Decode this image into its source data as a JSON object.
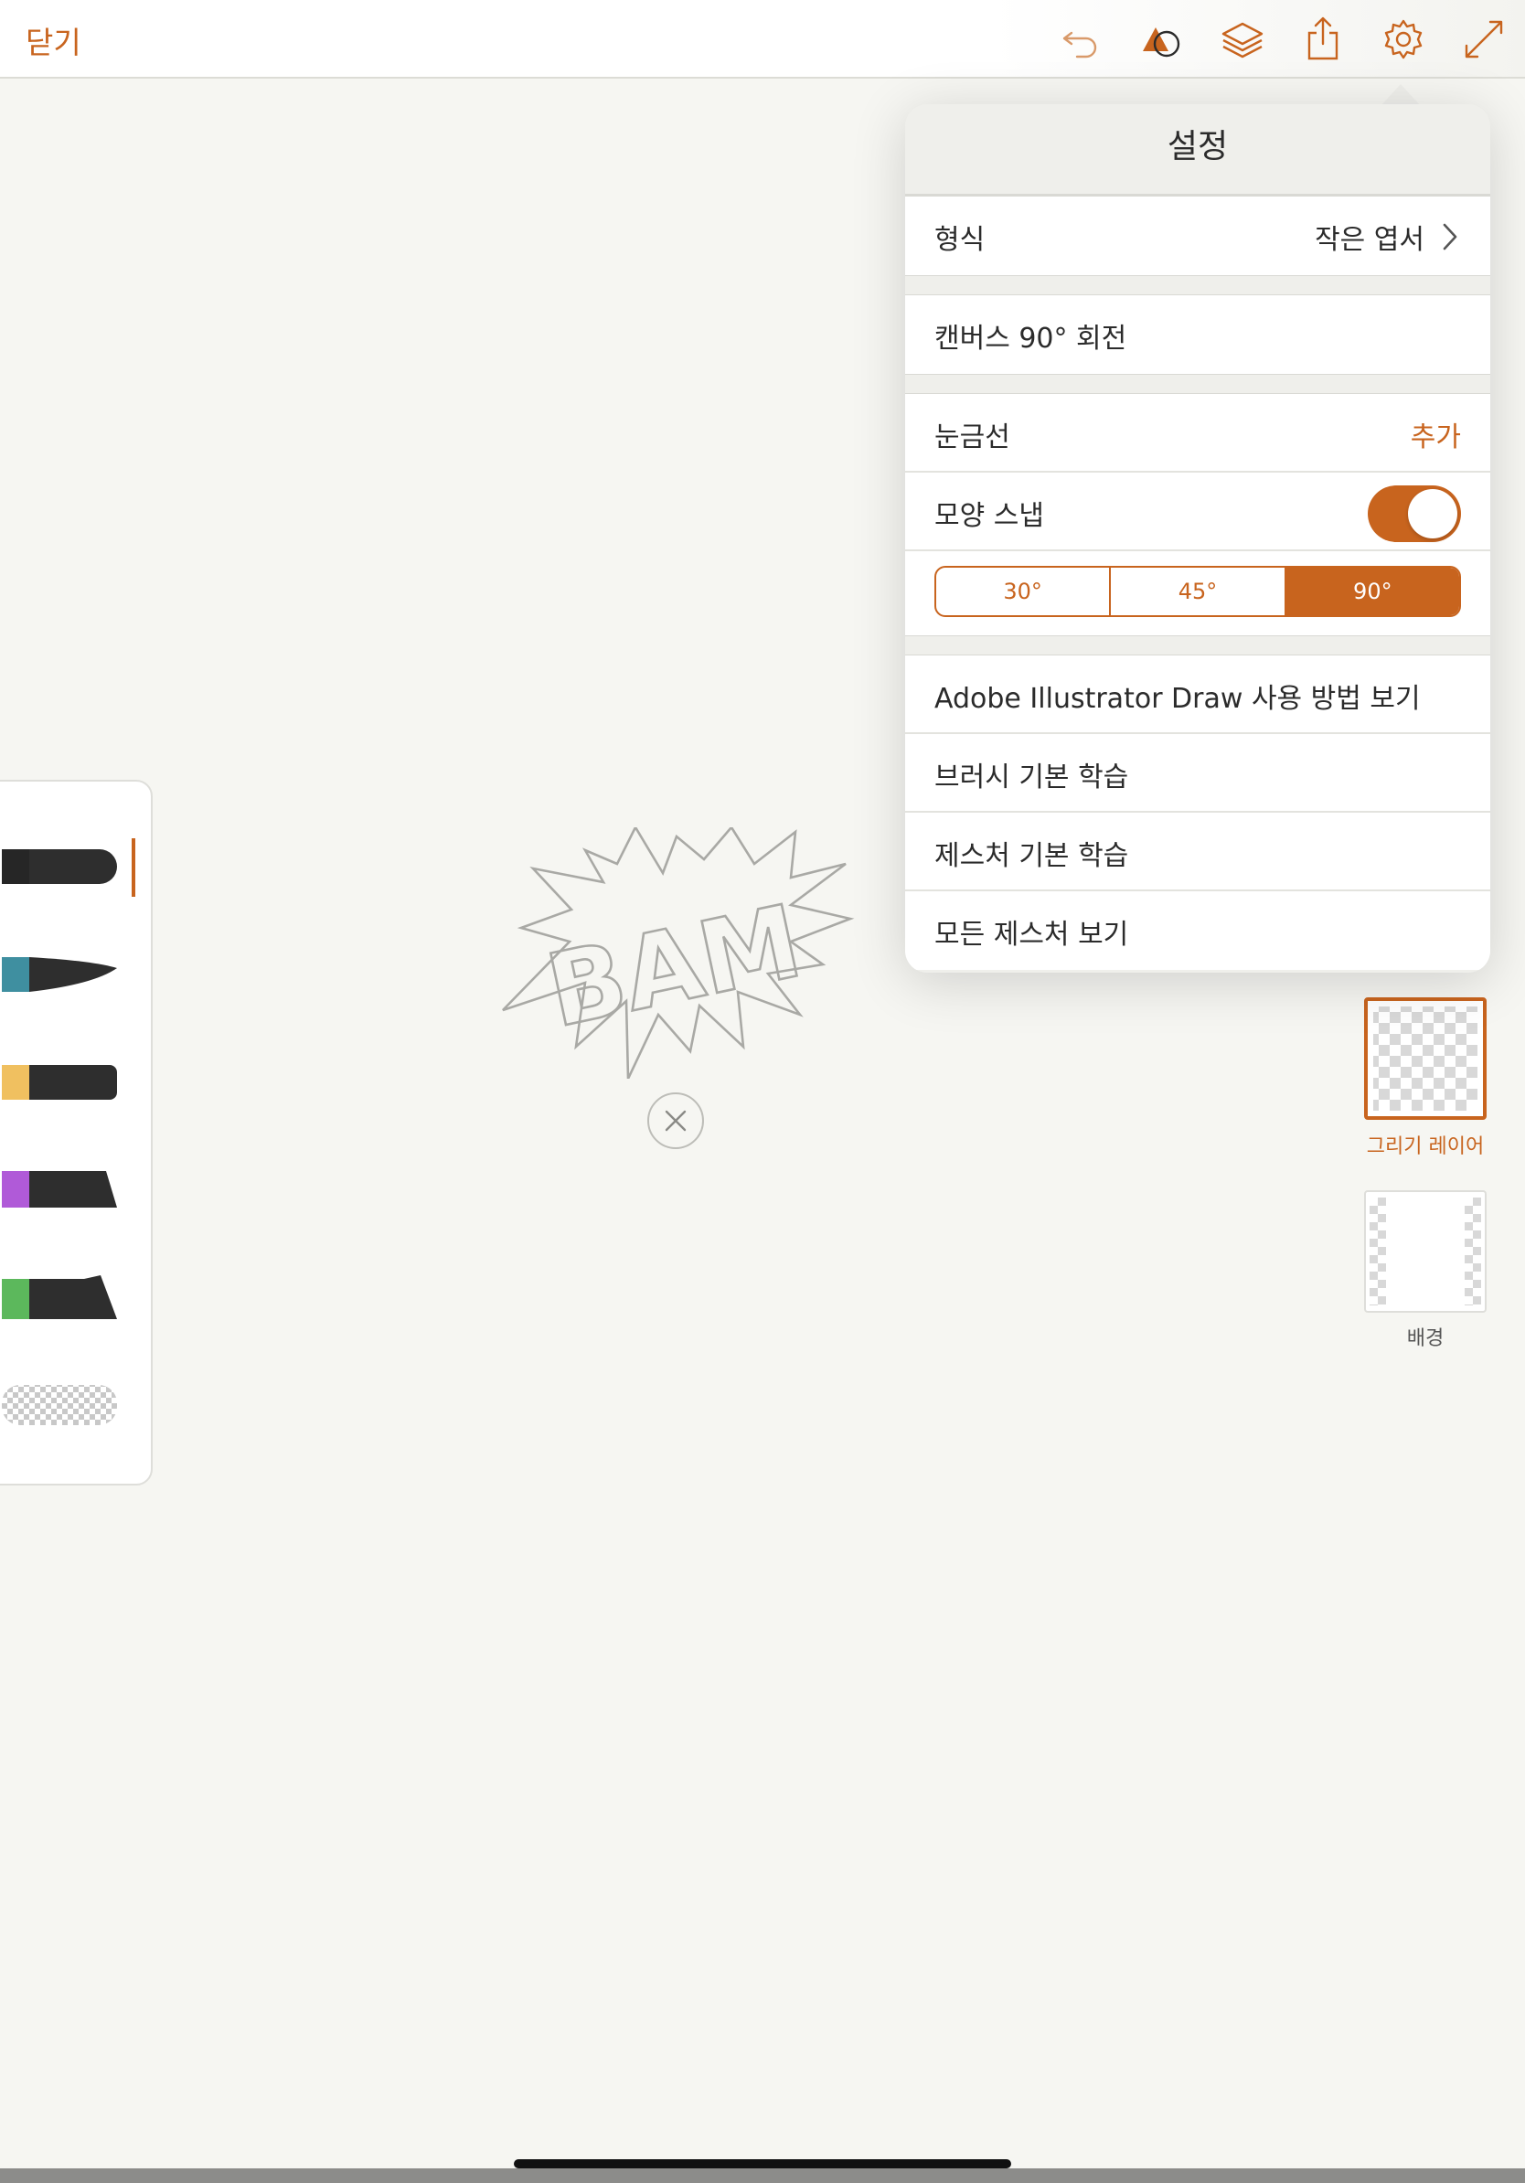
{
  "toolbar": {
    "close_label": "닫기",
    "icons": [
      "undo-icon",
      "shapes-icon",
      "layers-icon",
      "share-icon",
      "settings-icon",
      "fullscreen-icon"
    ]
  },
  "settings": {
    "title": "설정",
    "format": {
      "label": "형식",
      "value": "작은 엽서"
    },
    "rotate_canvas": {
      "label": "캔버스 90° 회전"
    },
    "gridlines": {
      "label": "눈금선",
      "action": "추가"
    },
    "shape_snap": {
      "label": "모양 스냅",
      "enabled": true
    },
    "angles": {
      "options": [
        "30°",
        "45°",
        "90°"
      ],
      "selected": "90°"
    },
    "help": {
      "items": [
        "Adobe Illustrator Draw 사용 방법 보기",
        "브러시 기본 학습",
        "제스처 기본 학습",
        "모든 제스처 보기"
      ]
    }
  },
  "brushes": {
    "items": [
      {
        "name": "brush-round",
        "color": "#2e2e2e",
        "selected": true
      },
      {
        "name": "brush-taper",
        "color": "#3f8fa0",
        "selected": false
      },
      {
        "name": "brush-flat",
        "color": "#f0c060",
        "selected": false
      },
      {
        "name": "brush-chisel",
        "color": "#b05ad8",
        "selected": false
      },
      {
        "name": "brush-wide",
        "color": "#5cb85c",
        "selected": false
      },
      {
        "name": "brush-eraser",
        "color": "#cccccc",
        "selected": false
      }
    ]
  },
  "canvas": {
    "shape_text": "BAM"
  },
  "layers": {
    "drawing_label": "그리기 레이어",
    "background_label": "배경"
  },
  "colors": {
    "accent": "#c8641e",
    "canvas_bg": "#f6f6f2",
    "panel_bg": "#ffffff"
  }
}
